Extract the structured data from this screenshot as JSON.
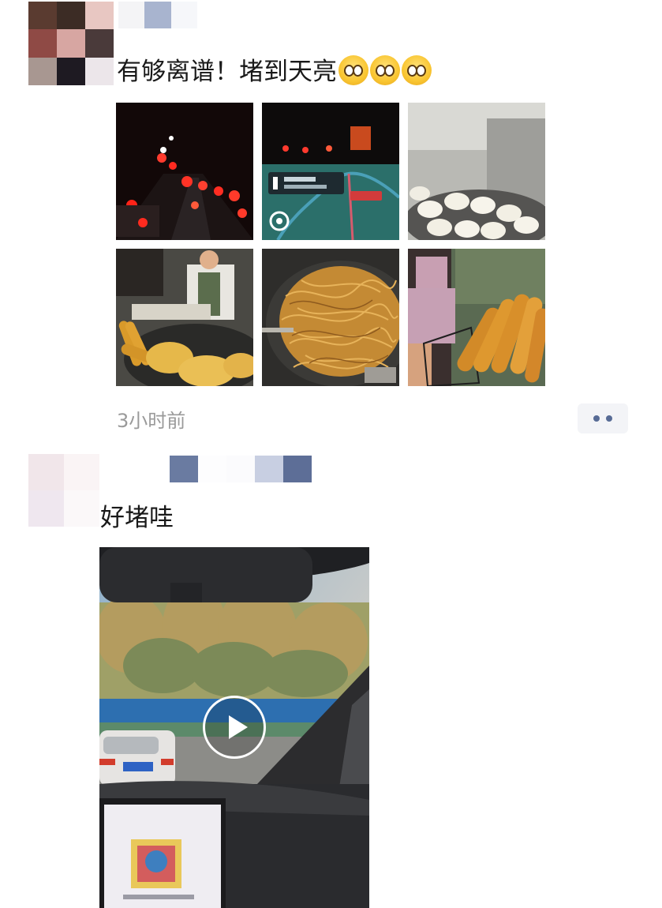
{
  "posts": [
    {
      "text": "有够离谱！堵到天亮",
      "emoji_icons": [
        "grimace-emoji-icon",
        "grimace-emoji-icon",
        "grimace-emoji-icon"
      ],
      "photos": [
        "traffic-jam-night",
        "car-navigation-screen",
        "steamed-buns",
        "fried-dough-stall",
        "fried-noodles",
        "fried-dough-sticks"
      ],
      "time": "3小时前",
      "actions_icon": "two-dots-icon"
    },
    {
      "text": "好堵哇",
      "media": "video",
      "play_icon": "play-icon"
    }
  ],
  "colors": {
    "link_blue": "#576b95",
    "time_gray": "#9a9a9a",
    "action_bg": "#f3f4f7"
  }
}
